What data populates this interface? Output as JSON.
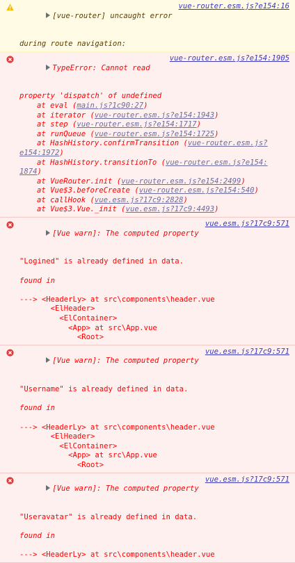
{
  "messages": [
    {
      "level": "warning",
      "icon": "warning-icon",
      "text1": "[vue-router] uncaught error",
      "text2": "during route navigation:",
      "source": "vue-router.esm.js?e154:16"
    },
    {
      "level": "error",
      "icon": "error-icon",
      "head": "TypeError: Cannot read",
      "source": "vue-router.esm.js?e154:1905",
      "head2": "property 'dispatch' of undefined",
      "frames": [
        {
          "fn": "at eval (",
          "loc": "main.js?1c90:27",
          "end": ")"
        },
        {
          "fn": "at iterator (",
          "loc": "vue-router.esm.js?e154:1943",
          "end": ")"
        },
        {
          "fn": "at step (",
          "loc": "vue-router.esm.js?e154:1717",
          "end": ")"
        },
        {
          "fn": "at runQueue (",
          "loc": "vue-router.esm.js?e154:1725",
          "end": ")"
        },
        {
          "fn": "at HashHistory.confirmTransition (",
          "loc": "vue-router.esm.js?",
          "loc2": "e154:1972",
          "end": ")"
        },
        {
          "fn": "at HashHistory.transitionTo (",
          "loc": "vue-router.esm.js?e154:",
          "loc2": "1874",
          "end": ")"
        },
        {
          "fn": "at VueRouter.init (",
          "loc": "vue-router.esm.js?e154:2499",
          "end": ")"
        },
        {
          "fn": "at Vue$3.beforeCreate (",
          "loc": "vue-router.esm.js?e154:540",
          "end": ")"
        },
        {
          "fn": "at callHook (",
          "loc": "vue.esm.js?17c9:2828",
          "end": ")"
        },
        {
          "fn": "at Vue$3.Vue._init (",
          "loc": "vue.esm.js?17c9:4493",
          "end": ")"
        }
      ]
    },
    {
      "level": "error",
      "icon": "error-icon",
      "head": "[Vue warn]: The computed property",
      "source": "vue.esm.js?17c9:571",
      "head2": "\"Logined\" is already defined in data.",
      "found": "found in",
      "trace": [
        "---> <HeaderLy> at src\\components\\header.vue",
        "       <ElHeader>",
        "         <ElContainer>",
        "           <App> at src\\App.vue",
        "             <Root>"
      ]
    },
    {
      "level": "error",
      "icon": "error-icon",
      "head": "[Vue warn]: The computed property",
      "source": "vue.esm.js?17c9:571",
      "head2": "\"Username\" is already defined in data.",
      "found": "found in",
      "trace": [
        "---> <HeaderLy> at src\\components\\header.vue",
        "       <ElHeader>",
        "         <ElContainer>",
        "           <App> at src\\App.vue",
        "             <Root>"
      ]
    },
    {
      "level": "error",
      "icon": "error-icon",
      "head": "[Vue warn]: The computed property",
      "source": "vue.esm.js?17c9:571",
      "head2": "\"Useravatar\" is already defined in data.",
      "found": "found in",
      "trace": [
        "---> <HeaderLy> at src\\components\\header.vue"
      ]
    }
  ],
  "colors": {
    "error_bg": "#fff0f0",
    "error_text": "#fe0000",
    "warning_bg": "#fffbe5",
    "warning_text": "#5c3c00",
    "link": "#3a3ab8"
  }
}
